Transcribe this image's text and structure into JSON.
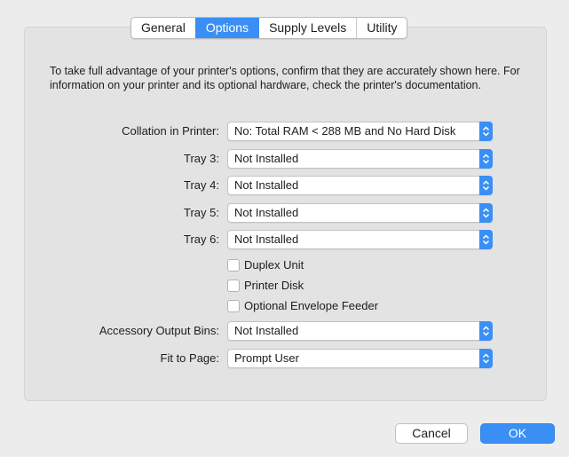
{
  "tabs": [
    {
      "label": "General"
    },
    {
      "label": "Options"
    },
    {
      "label": "Supply Levels"
    },
    {
      "label": "Utility"
    }
  ],
  "active_tab": "Options",
  "description": "To take full advantage of your printer's options, confirm that they are accurately shown here. For information on your printer and its optional hardware, check the printer's documentation.",
  "options": {
    "collation": {
      "label": "Collation in Printer:",
      "value": "No: Total RAM < 288 MB and No Hard Disk"
    },
    "tray3": {
      "label": "Tray 3:",
      "value": "Not Installed"
    },
    "tray4": {
      "label": "Tray 4:",
      "value": "Not Installed"
    },
    "tray5": {
      "label": "Tray 5:",
      "value": "Not Installed"
    },
    "tray6": {
      "label": "Tray 6:",
      "value": "Not Installed"
    },
    "duplex": {
      "label": "Duplex Unit",
      "checked": false
    },
    "printer_disk": {
      "label": "Printer Disk",
      "checked": false
    },
    "envelope_feeder": {
      "label": "Optional Envelope Feeder",
      "checked": false
    },
    "output_bins": {
      "label": "Accessory Output Bins:",
      "value": "Not Installed"
    },
    "fit_to_page": {
      "label": "Fit to Page:",
      "value": "Prompt User"
    }
  },
  "buttons": {
    "cancel": "Cancel",
    "ok": "OK"
  },
  "colors": {
    "accent": "#3a8ff4"
  }
}
